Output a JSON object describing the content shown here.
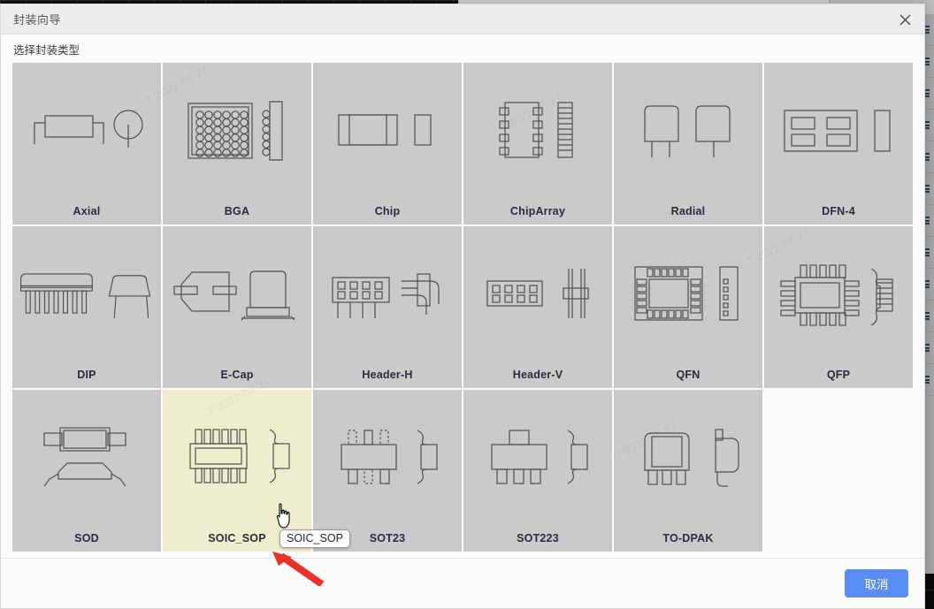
{
  "dialog": {
    "title": "封装向导",
    "subtitle": "选择封装类型",
    "close_icon": "close-icon",
    "cancel_label": "取消"
  },
  "packages": [
    {
      "label": "Axial",
      "art": "axial",
      "selected": false
    },
    {
      "label": "BGA",
      "art": "bga",
      "selected": false
    },
    {
      "label": "Chip",
      "art": "chip",
      "selected": false
    },
    {
      "label": "ChipArray",
      "art": "chiparray",
      "selected": false
    },
    {
      "label": "Radial",
      "art": "radial",
      "selected": false
    },
    {
      "label": "DFN-4",
      "art": "dfn4",
      "selected": false
    },
    {
      "label": "DIP",
      "art": "dip",
      "selected": false
    },
    {
      "label": "E-Cap",
      "art": "ecap",
      "selected": false
    },
    {
      "label": "Header-H",
      "art": "headerh",
      "selected": false
    },
    {
      "label": "Header-V",
      "art": "headerv",
      "selected": false
    },
    {
      "label": "QFN",
      "art": "qfn",
      "selected": false
    },
    {
      "label": "QFP",
      "art": "qfp",
      "selected": false
    },
    {
      "label": "SOD",
      "art": "sod",
      "selected": false
    },
    {
      "label": "SOIC_SOP",
      "art": "soic",
      "selected": true
    },
    {
      "label": "SOT23",
      "art": "sot23",
      "selected": false
    },
    {
      "label": "SOT223",
      "art": "sot223",
      "selected": false
    },
    {
      "label": "TO-DPAK",
      "art": "todpak",
      "selected": false
    }
  ],
  "tooltip": {
    "text": "SOIC_SOP"
  },
  "annotation": {
    "arrow_color": "#e8322a",
    "points_to": "SOIC_SOP"
  },
  "colors": {
    "card_bg": "#cacaca",
    "card_selected_bg": "#edeecd",
    "accent_button": "#5a8df4",
    "label_text": "#2b2b3a",
    "line_art": "#4f4f4f"
  }
}
